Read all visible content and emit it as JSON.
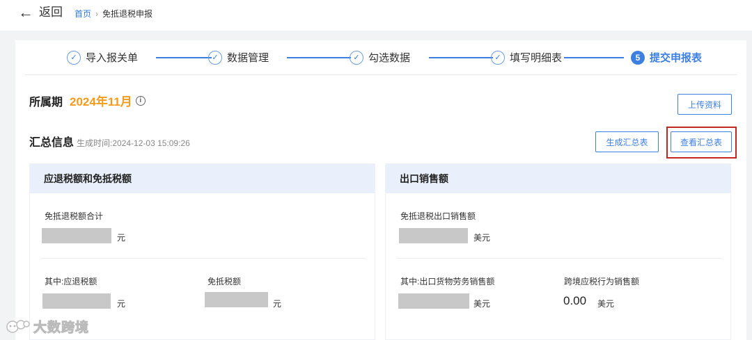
{
  "header": {
    "back_label": "返回",
    "breadcrumb": {
      "home": "首页",
      "separator": "›",
      "current": "免抵退税申报"
    }
  },
  "steps": [
    {
      "label": "导入报关单",
      "status": "done"
    },
    {
      "label": "数据管理",
      "status": "done"
    },
    {
      "label": "勾选数据",
      "status": "done"
    },
    {
      "label": "填写明细表",
      "status": "done"
    },
    {
      "label": "提交申报表",
      "status": "active",
      "number": "5"
    }
  ],
  "period": {
    "label": "所属期",
    "value": "2024年11月",
    "info_icon": "info-icon"
  },
  "buttons": {
    "upload": "上传资料",
    "generate": "生成汇总表",
    "view": "查看汇总表"
  },
  "summary": {
    "title": "汇总信息",
    "time_label": "生成时间:",
    "time": "2024-12-03 15:09:26"
  },
  "left_panel": {
    "title": "应退税额和免抵税额",
    "total_label": "免抵退税额合计",
    "total_unit": "元",
    "refund_label": "其中:应退税额",
    "refund_unit": "元",
    "exempt_label": "免抵税额",
    "exempt_unit": "元"
  },
  "right_panel": {
    "title": "出口销售额",
    "total_label": "免抵退税出口销售额",
    "total_unit": "美元",
    "goods_label": "其中:出口货物劳务销售额",
    "goods_unit": "美元",
    "cross_label": "跨境应税行为销售额",
    "cross_value": "0.00",
    "cross_unit": "美元"
  },
  "watermark": {
    "text": "大数跨境"
  },
  "colors": {
    "accent": "#3d7fe0",
    "period": "#f59b1b",
    "highlight": "#c0281f",
    "panel_head": "#e9f0fb"
  }
}
